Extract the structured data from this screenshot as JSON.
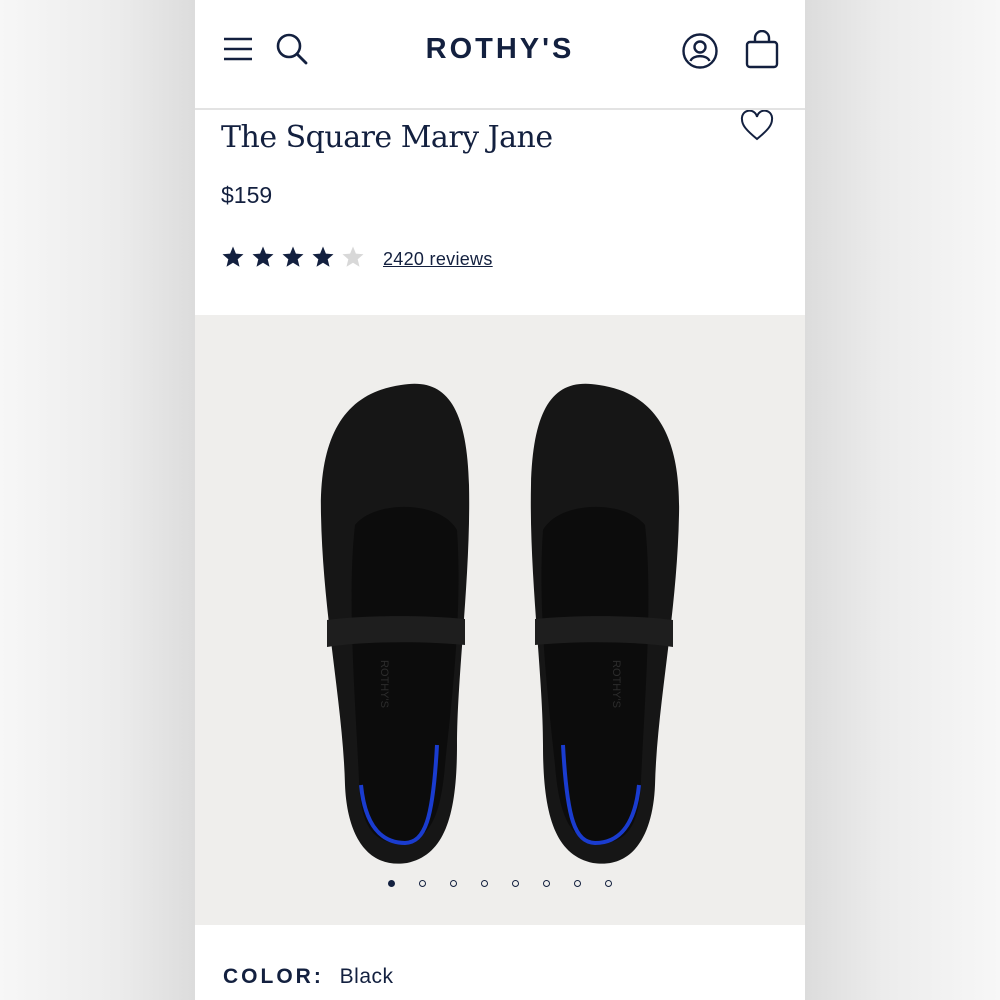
{
  "header": {
    "brand": "ROTHY'S",
    "icons": [
      "menu-icon",
      "search-icon",
      "account-icon",
      "bag-icon"
    ]
  },
  "product": {
    "title": "The Square Mary Jane",
    "price": "$159",
    "rating": {
      "value": 4,
      "max": 5
    },
    "reviews_label": "2420 reviews",
    "wishlist_icon": "heart-icon"
  },
  "gallery": {
    "image_count": 8,
    "active_index": 0
  },
  "color": {
    "label": "COLOR:",
    "value": "Black"
  },
  "colors": {
    "navy": "#13203f",
    "gallery_bg": "#efeeec",
    "star_inactive": "#d8d8d8",
    "shoe": "#141414",
    "accent_blue": "#1a3ccf"
  }
}
